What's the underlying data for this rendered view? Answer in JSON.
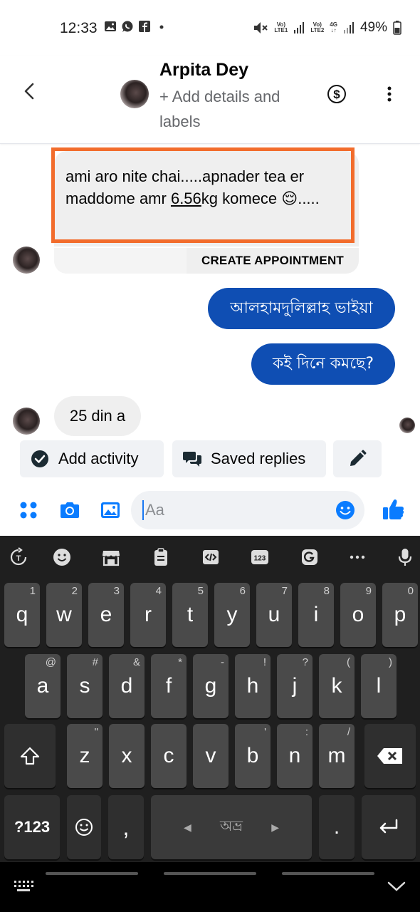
{
  "status_bar": {
    "time": "12:33",
    "battery": "49%",
    "lte1": "Vo)\nLTE1",
    "lte2": "Vo)\nLTE2",
    "net": "4G",
    "icons": [
      "gallery-icon",
      "whatsapp-icon",
      "facebook-icon",
      "dot-icon",
      "mute-icon",
      "signal-icon",
      "battery-icon"
    ]
  },
  "header": {
    "name": "Arpita Dey",
    "subtitle": "+ Add details and labels"
  },
  "messages": [
    {
      "direction": "in",
      "text_before": "ami aro nite chai.....apnader tea er maddome amr ",
      "text_link": "6.56",
      "text_after": "kg komece 😌.....",
      "action": "CREATE APPOINTMENT"
    },
    {
      "direction": "out",
      "text": "আলহামদুলিল্লাহ ভাইয়া"
    },
    {
      "direction": "out",
      "text": "কই দিনে কমছে?"
    },
    {
      "direction": "in",
      "text": "25 din a"
    }
  ],
  "quick_actions": {
    "add_activity": "Add activity",
    "saved_replies": "Saved replies"
  },
  "composer": {
    "placeholder": "Aa"
  },
  "keyboard": {
    "row1": [
      {
        "k": "q",
        "h": "1"
      },
      {
        "k": "w",
        "h": "2"
      },
      {
        "k": "e",
        "h": "3"
      },
      {
        "k": "r",
        "h": "4"
      },
      {
        "k": "t",
        "h": "5"
      },
      {
        "k": "y",
        "h": "6"
      },
      {
        "k": "u",
        "h": "7"
      },
      {
        "k": "i",
        "h": "8"
      },
      {
        "k": "o",
        "h": "9"
      },
      {
        "k": "p",
        "h": "0"
      }
    ],
    "row2": [
      {
        "k": "a",
        "h": "@"
      },
      {
        "k": "s",
        "h": "#"
      },
      {
        "k": "d",
        "h": "&"
      },
      {
        "k": "f",
        "h": "*"
      },
      {
        "k": "g",
        "h": "-"
      },
      {
        "k": "h",
        "h": "!"
      },
      {
        "k": "j",
        "h": "?"
      },
      {
        "k": "k",
        "h": "("
      },
      {
        "k": "l",
        "h": ")"
      }
    ],
    "row3": [
      {
        "k": "z",
        "h": "\""
      },
      {
        "k": "x",
        "h": ""
      },
      {
        "k": "c",
        "h": ""
      },
      {
        "k": "v",
        "h": ""
      },
      {
        "k": "b",
        "h": "'"
      },
      {
        "k": "n",
        "h": ":"
      },
      {
        "k": "m",
        "h": "/"
      }
    ],
    "symbols_label": "?123",
    "comma": ",",
    "space_label": "অভ্র",
    "period": "."
  }
}
